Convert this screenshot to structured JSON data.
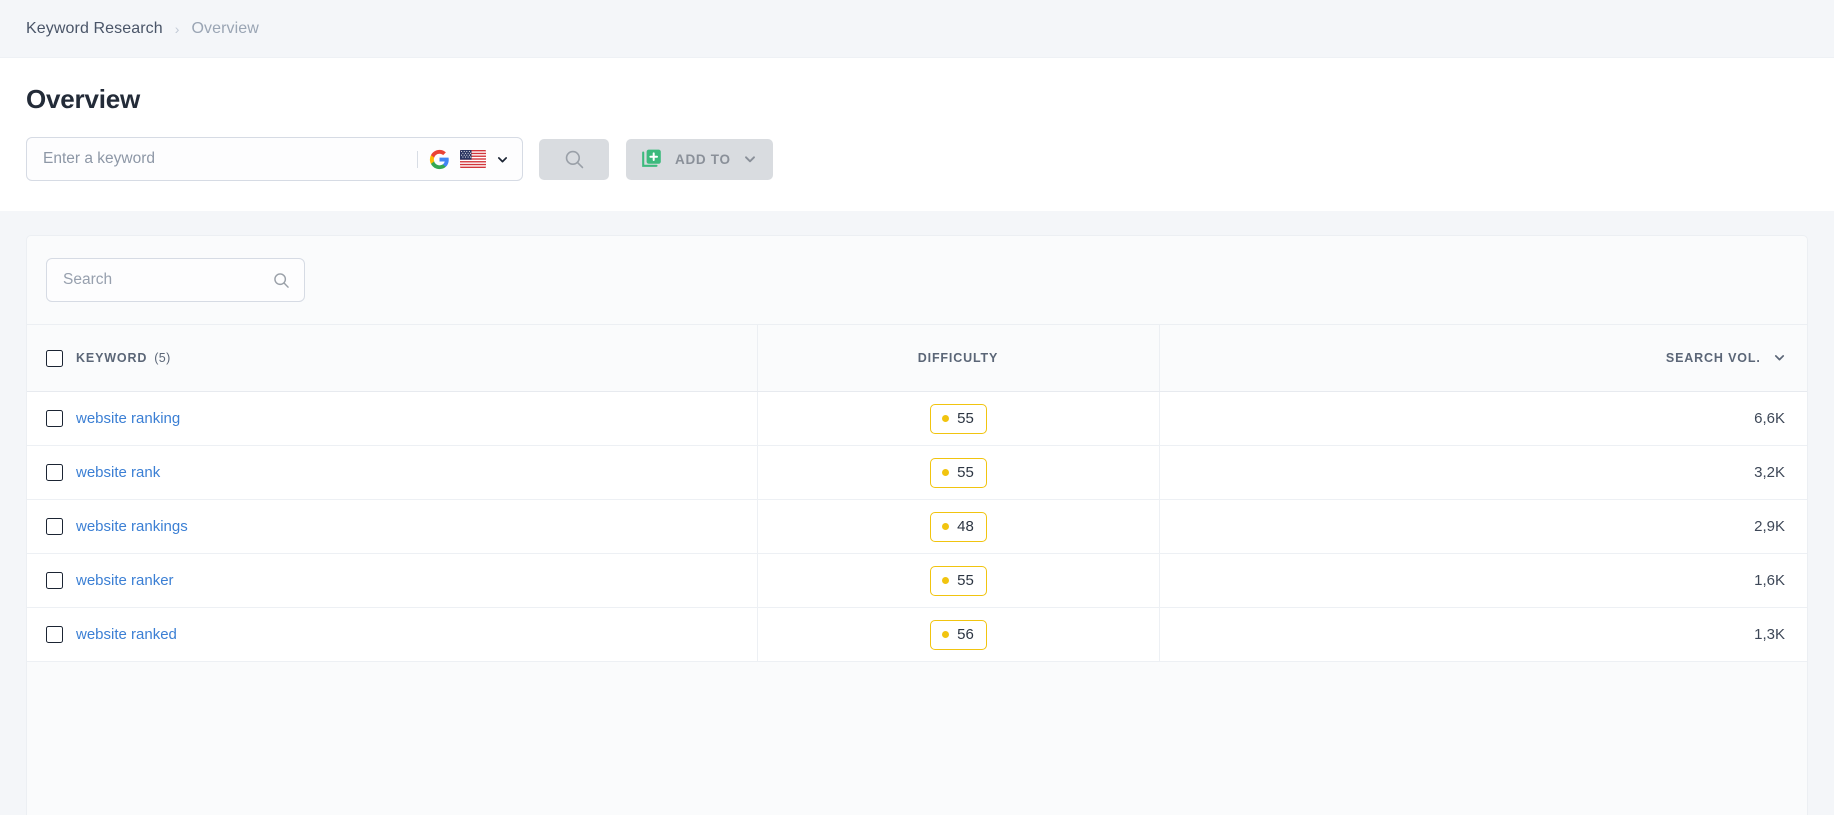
{
  "breadcrumb": {
    "parent": "Keyword Research",
    "separator": "›",
    "current": "Overview"
  },
  "page": {
    "title": "Overview"
  },
  "keyword_search": {
    "placeholder": "Enter a keyword",
    "value": "",
    "engine_icon": "google-icon",
    "country_icon": "us-flag-icon",
    "dropdown_icon": "chevron-down-icon",
    "search_button_icon": "search-icon"
  },
  "add_to": {
    "label": "ADD TO",
    "icon": "add-to-list-icon",
    "dropdown_icon": "chevron-down-icon",
    "accent": "#3cba7d"
  },
  "table_search": {
    "placeholder": "Search",
    "value": "",
    "icon": "search-icon"
  },
  "table": {
    "columns": {
      "keyword": "KEYWORD",
      "keyword_count": "(5)",
      "difficulty": "DIFFICULTY",
      "search_volume": "SEARCH VOL."
    },
    "sort_icon": "chevron-down-icon",
    "select_all_checked": false,
    "rows": [
      {
        "keyword": "website ranking",
        "difficulty": "55",
        "volume": "6,6K"
      },
      {
        "keyword": "website rank",
        "difficulty": "55",
        "volume": "3,2K"
      },
      {
        "keyword": "website rankings",
        "difficulty": "48",
        "volume": "2,9K"
      },
      {
        "keyword": "website ranker",
        "difficulty": "55",
        "volume": "1,6K"
      },
      {
        "keyword": "website ranked",
        "difficulty": "56",
        "volume": "1,3K"
      }
    ]
  },
  "colors": {
    "link": "#3b7fd4",
    "difficulty_badge": "#f1c40f",
    "page_bg": "#f4f6f9"
  }
}
